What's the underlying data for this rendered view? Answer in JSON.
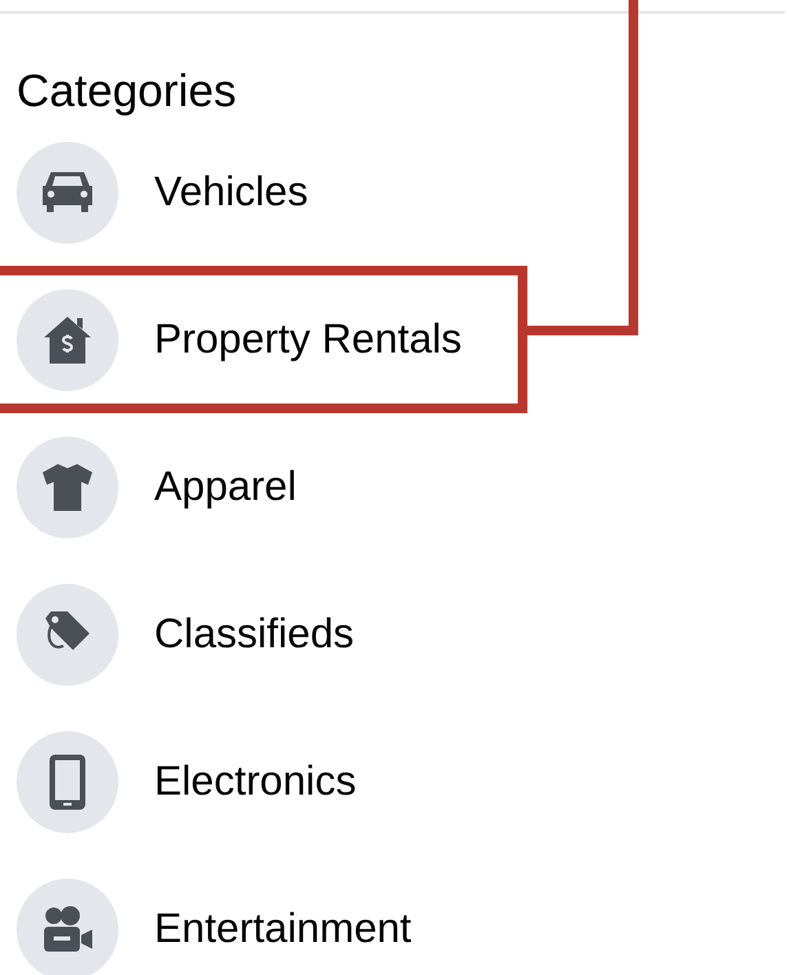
{
  "heading": "Categories",
  "categories": [
    {
      "label": "Vehicles",
      "highlighted": false
    },
    {
      "label": "Property Rentals",
      "highlighted": true
    },
    {
      "label": "Apparel",
      "highlighted": false
    },
    {
      "label": "Classifieds",
      "highlighted": false
    },
    {
      "label": "Electronics",
      "highlighted": false
    },
    {
      "label": "Entertainment",
      "highlighted": false
    }
  ]
}
